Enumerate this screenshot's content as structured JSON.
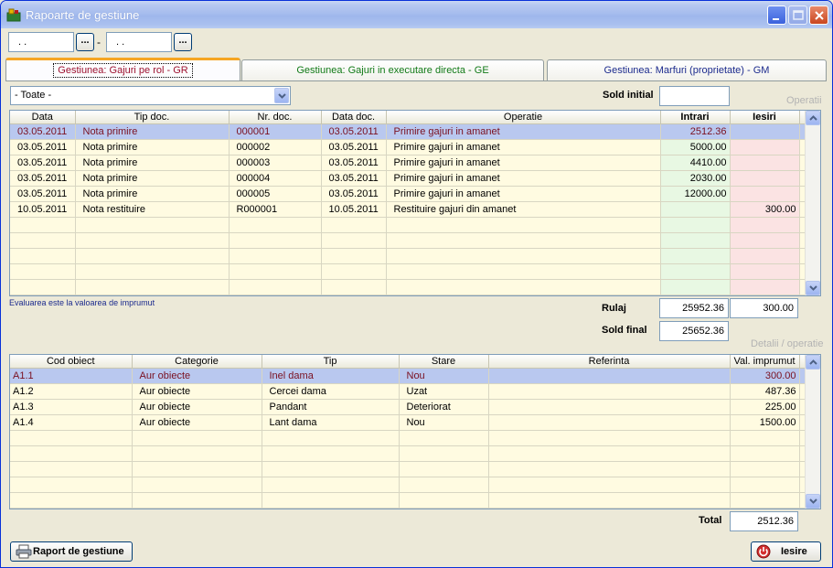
{
  "window": {
    "title": "Rapoarte de gestiune"
  },
  "dates": {
    "from": ".  .",
    "to": ".  .",
    "picker_label": "...",
    "separator": "-"
  },
  "tabs": [
    {
      "label": "Gestiunea: Gajuri pe rol - GR",
      "color": "#9d1230",
      "active": true
    },
    {
      "label": "Gestiunea: Gajuri in executare directa - GE",
      "color": "#117a17",
      "active": false
    },
    {
      "label": "Gestiunea: Marfuri (proprietate) - GM",
      "color": "#1b2a8d",
      "active": false
    }
  ],
  "filter": {
    "selected": "- Toate -"
  },
  "sold_initial": {
    "label": "Sold initial",
    "value": ""
  },
  "operatii_label": "Operatii",
  "operations": {
    "columns": [
      "Data",
      "Tip doc.",
      "Nr. doc.",
      "Data doc.",
      "Operatie",
      "Intrari",
      "Iesiri"
    ],
    "rows": [
      [
        "03.05.2011",
        "Nota primire",
        "000001",
        "03.05.2011",
        "Primire gajuri in amanet",
        "2512.36",
        ""
      ],
      [
        "03.05.2011",
        "Nota primire",
        "000002",
        "03.05.2011",
        "Primire gajuri in amanet",
        "5000.00",
        ""
      ],
      [
        "03.05.2011",
        "Nota primire",
        "000003",
        "03.05.2011",
        "Primire gajuri in amanet",
        "4410.00",
        ""
      ],
      [
        "03.05.2011",
        "Nota primire",
        "000004",
        "03.05.2011",
        "Primire gajuri in amanet",
        "2030.00",
        ""
      ],
      [
        "03.05.2011",
        "Nota primire",
        "000005",
        "03.05.2011",
        "Primire gajuri in amanet",
        "12000.00",
        ""
      ],
      [
        "10.05.2011",
        "Nota restituire",
        "R000001",
        "10.05.2011",
        "Restituire gajuri din amanet",
        "",
        "300.00"
      ]
    ]
  },
  "note": "Evaluarea este la valoarea de imprumut",
  "rulaj": {
    "label": "Rulaj",
    "intrari": "25952.36",
    "iesiri": "300.00"
  },
  "sold_final": {
    "label": "Sold final",
    "value": "25652.36"
  },
  "detalii_label": "Detalii / operatie",
  "details": {
    "columns": [
      "Cod obiect",
      "Categorie",
      "Tip",
      "Stare",
      "Referinta",
      "Val. imprumut"
    ],
    "rows": [
      [
        "A1.1",
        "Aur obiecte",
        "Inel dama",
        "Nou",
        "",
        "300.00"
      ],
      [
        "A1.2",
        "Aur obiecte",
        "Cercei dama",
        "Uzat",
        "",
        "487.36"
      ],
      [
        "A1.3",
        "Aur obiecte",
        "Pandant",
        "Deteriorat",
        "",
        "225.00"
      ],
      [
        "A1.4",
        "Aur obiecte",
        "Lant dama",
        "Nou",
        "",
        "1500.00"
      ]
    ]
  },
  "total": {
    "label": "Total",
    "value": "2512.36"
  },
  "buttons": {
    "report": "Raport de gestiune",
    "exit": "Iesire"
  }
}
